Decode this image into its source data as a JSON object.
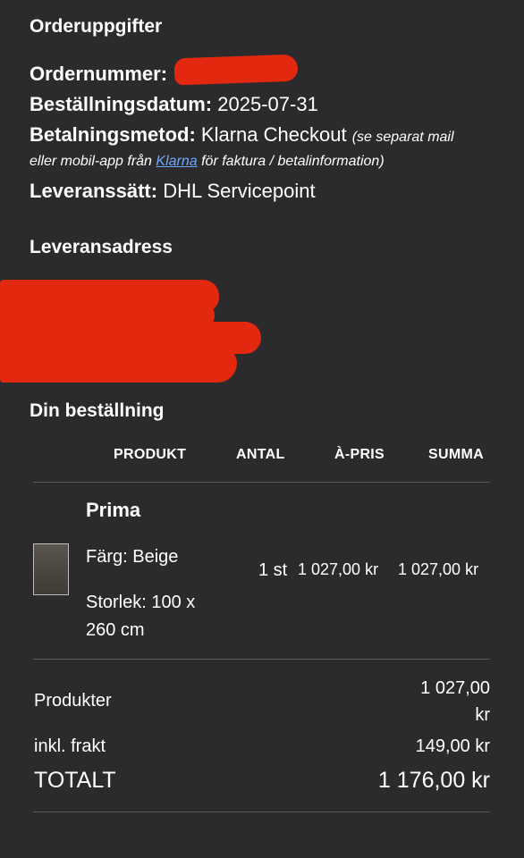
{
  "order_details": {
    "heading": "Orderuppgifter",
    "order_number_label": "Ordernummer:",
    "order_date_label": "Beställningsdatum:",
    "order_date_value": "2025-07-31",
    "payment_label": "Betalningsmetod:",
    "payment_value": "Klarna Checkout",
    "payment_note_start": "(se separat mail",
    "payment_note_cont": "eller mobil-app från",
    "payment_note_link": "Klarna",
    "payment_note_end": "för faktura / betalinformation)",
    "delivery_label": "Leveranssätt:",
    "delivery_value": "DHL Servicepoint"
  },
  "address": {
    "heading": "Leveransadress"
  },
  "order": {
    "heading": "Din beställning",
    "columns": [
      "PRODUKT",
      "ANTAL",
      "À-PRIS",
      "SUMMA"
    ],
    "item": {
      "name": "Prima",
      "color": "Färg: Beige",
      "size_line1": "Storlek: 100 x",
      "size_line2": "260 cm",
      "quantity": "1 st",
      "unit_price": "1 027,00 kr",
      "total": "1 027,00 kr"
    }
  },
  "totals": {
    "products_label": "Produkter",
    "products_value_line1": "1 027,00",
    "products_value_line2": "kr",
    "shipping_label": "inkl. frakt",
    "shipping_value": "149,00 kr",
    "total_label": "TOTALT",
    "total_value": "1 176,00 kr"
  },
  "colors": {
    "background": "#2b2b2d",
    "redaction": "#e2290f",
    "link": "#6ea6ff"
  }
}
